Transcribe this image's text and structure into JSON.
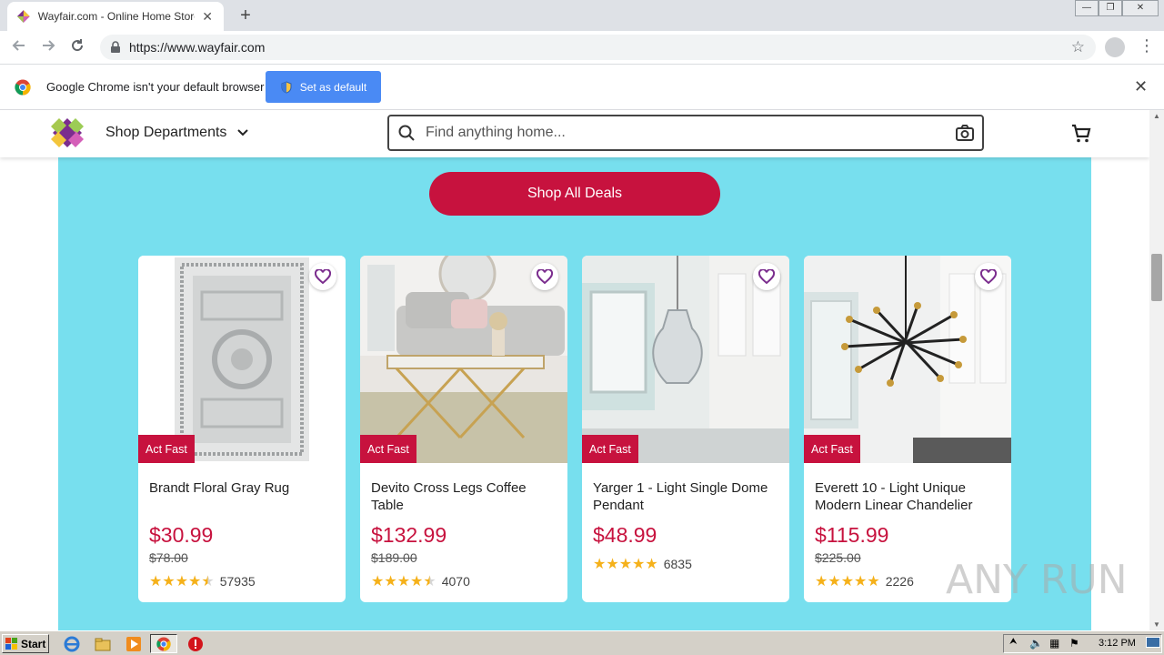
{
  "browser": {
    "tab_title": "Wayfair.com - Online Home Store for Furniture",
    "tab_close": "✕",
    "new_tab": "+",
    "url": "https://www.wayfair.com",
    "window_controls": [
      "—",
      "❐",
      "✕"
    ]
  },
  "infobar": {
    "message": "Google Chrome isn't your default browser",
    "button_label": "Set as default",
    "close": "✕"
  },
  "header": {
    "shop_departments": "Shop Departments",
    "search_placeholder": "Find anything home..."
  },
  "deals": {
    "button_label": "Shop All Deals",
    "products": [
      {
        "name": "Brandt Floral Gray Rug",
        "badge": "Act Fast",
        "price": "$30.99",
        "was": "$78.00",
        "rating": 4.5,
        "reviews": "57935"
      },
      {
        "name": "Devito Cross Legs Coffee Table",
        "badge": "Act Fast",
        "price": "$132.99",
        "was": "$189.00",
        "rating": 4.5,
        "reviews": "4070"
      },
      {
        "name": "Yarger 1 - Light Single Dome Pendant",
        "badge": "Act Fast",
        "price": "$48.99",
        "was": "",
        "rating": 4.8,
        "reviews": "6835"
      },
      {
        "name": "Everett 10 - Light Unique Modern Linear Chandelier",
        "badge": "Act Fast",
        "price": "$115.99",
        "was": "$225.00",
        "rating": 4.8,
        "reviews": "2226"
      }
    ]
  },
  "colors": {
    "deals_bg": "#77dfee",
    "brand_red": "#c7123e",
    "star": "#f5b11a"
  },
  "watermark": "ANY RUN",
  "taskbar": {
    "start_label": "Start",
    "clock": "3:12 PM"
  }
}
